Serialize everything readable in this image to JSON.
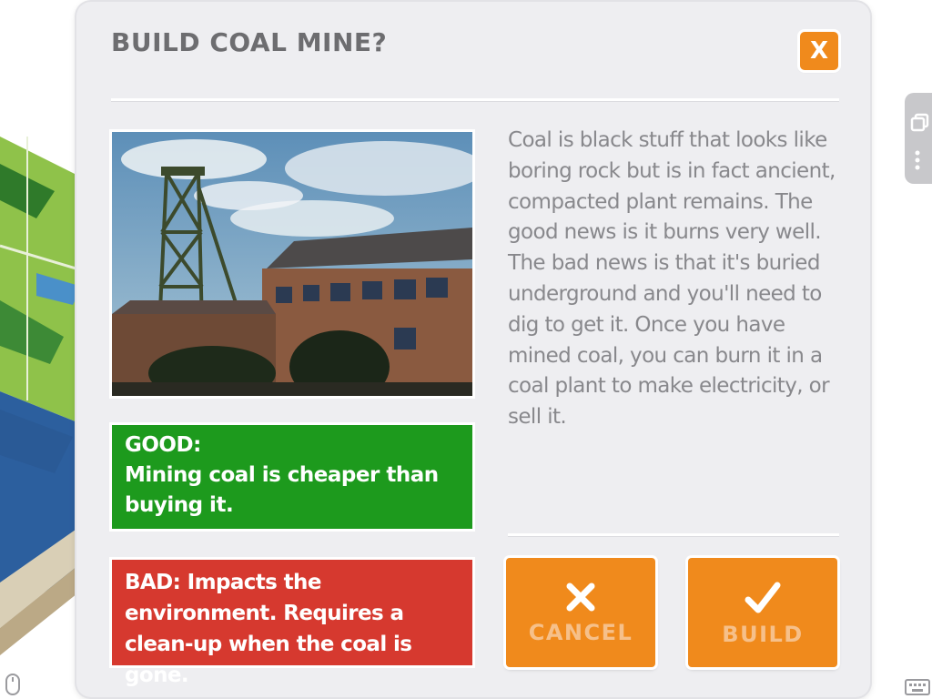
{
  "dialog": {
    "title": "BUILD COAL MINE?",
    "close_label": "X",
    "description": "Coal is black stuff that looks like boring rock but is in fact ancient, compacted plant remains. The good news is it burns very well. The bad news is that it's buried underground and you'll need to dig to get it. Once you have mined coal, you can burn it in a coal plant to make electricity, or sell it.",
    "good": {
      "heading": "GOOD:",
      "text": "Mining coal is cheaper than buying it."
    },
    "bad": {
      "text": "BAD: Impacts the environment. Requires a clean-up when the coal is gone."
    },
    "cancel_label": "CANCEL",
    "build_label": "BUILD"
  },
  "icons": {
    "close": "close-icon",
    "cancel": "x-icon",
    "build": "checkmark-icon",
    "side_copy": "copy-icon",
    "side_menu": "more-vertical-icon",
    "mouse": "mouse-icon",
    "keyboard": "keyboard-icon"
  },
  "colors": {
    "accent_orange": "#f08a1c",
    "good_green": "#1d9a1d",
    "bad_red": "#d6392f",
    "panel_bg": "#eeeef1"
  }
}
